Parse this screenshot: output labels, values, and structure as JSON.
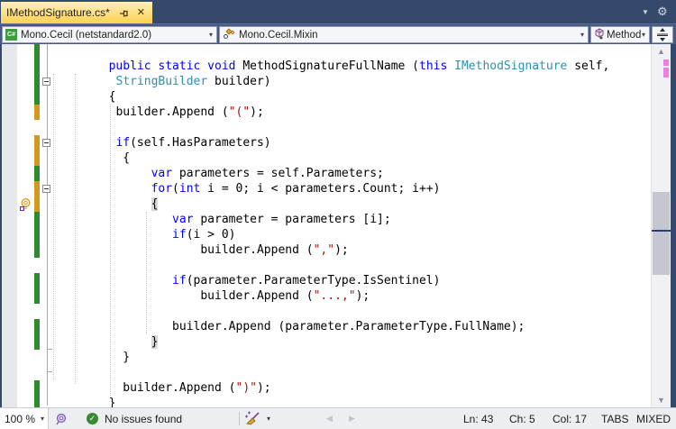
{
  "tab": {
    "title": "IMethodSignature.cs*"
  },
  "tabstrip": {
    "overflow_icon": "▼",
    "gear_icon": "⚙"
  },
  "navbar": {
    "project": "Mono.Cecil (netstandard2.0)",
    "type_name": "Mono.Cecil.Mixin",
    "member": "MethodSignature",
    "caret": "▾"
  },
  "editor": {
    "lines": [
      {
        "ind": 8,
        "bar": "g",
        "box": false,
        "segs": [
          [
            "kw",
            "public static void "
          ],
          [
            "pl",
            "MethodSignatureFullName ("
          ],
          [
            "kw",
            "this"
          ],
          [
            "pl",
            " "
          ],
          [
            "ty",
            "IMethodSignature"
          ],
          [
            "pl",
            " self,"
          ]
        ]
      },
      {
        "ind": 9,
        "bar": "g",
        "box": true,
        "segs": [
          [
            "ty",
            "StringBuilder"
          ],
          [
            "pl",
            " builder)"
          ]
        ]
      },
      {
        "ind": 8,
        "bar": "g",
        "box": false,
        "segs": [
          [
            "pl",
            "{"
          ]
        ]
      },
      {
        "ind": 9,
        "bar": "o",
        "box": false,
        "segs": [
          [
            "pl",
            "builder.Append ("
          ],
          [
            "st",
            "\"(\""
          ],
          [
            "pl",
            ");"
          ]
        ]
      },
      {
        "ind": 0,
        "bar": "",
        "box": false,
        "segs": []
      },
      {
        "ind": 9,
        "bar": "o",
        "box": true,
        "segs": [
          [
            "kw",
            "if"
          ],
          [
            "pl",
            "(self.HasParameters)"
          ]
        ]
      },
      {
        "ind": 10,
        "bar": "o",
        "box": false,
        "segs": [
          [
            "pl",
            "{"
          ]
        ]
      },
      {
        "ind": 14,
        "bar": "g",
        "box": false,
        "segs": [
          [
            "kw",
            "var"
          ],
          [
            "pl",
            " parameters = self.Parameters;"
          ]
        ]
      },
      {
        "ind": 14,
        "bar": "o",
        "box": true,
        "segs": [
          [
            "kw",
            "for"
          ],
          [
            "pl",
            "("
          ],
          [
            "kw",
            "int"
          ],
          [
            "pl",
            " i = 0; i < parameters.Count; i++)"
          ]
        ]
      },
      {
        "ind": 14,
        "bar": "o",
        "box": false,
        "hl": true,
        "bulb": true,
        "segs": [
          [
            "pl",
            "{"
          ]
        ]
      },
      {
        "ind": 17,
        "bar": "g",
        "box": false,
        "segs": [
          [
            "kw",
            "var"
          ],
          [
            "pl",
            " parameter = parameters [i];"
          ]
        ]
      },
      {
        "ind": 17,
        "bar": "g",
        "box": false,
        "segs": [
          [
            "kw",
            "if"
          ],
          [
            "pl",
            "(i > 0)"
          ]
        ]
      },
      {
        "ind": 21,
        "bar": "g",
        "box": false,
        "segs": [
          [
            "pl",
            "builder.Append ("
          ],
          [
            "st",
            "\",\""
          ],
          [
            "pl",
            ");"
          ]
        ]
      },
      {
        "ind": 0,
        "bar": "",
        "box": false,
        "segs": []
      },
      {
        "ind": 17,
        "bar": "g",
        "box": false,
        "segs": [
          [
            "kw",
            "if"
          ],
          [
            "pl",
            "(parameter.ParameterType.IsSentinel)"
          ]
        ]
      },
      {
        "ind": 21,
        "bar": "g",
        "box": false,
        "segs": [
          [
            "pl",
            "builder.Append ("
          ],
          [
            "st",
            "\"...,\""
          ],
          [
            "pl",
            ");"
          ]
        ]
      },
      {
        "ind": 0,
        "bar": "",
        "box": false,
        "segs": []
      },
      {
        "ind": 17,
        "bar": "g",
        "box": false,
        "segs": [
          [
            "pl",
            "builder.Append (parameter.ParameterType.FullName);"
          ]
        ]
      },
      {
        "ind": 14,
        "bar": "g",
        "box": false,
        "hl": true,
        "segs": [
          [
            "pl",
            "}"
          ]
        ]
      },
      {
        "ind": 10,
        "bar": "",
        "box": false,
        "segs": [
          [
            "pl",
            "}"
          ]
        ]
      },
      {
        "ind": 0,
        "bar": "",
        "box": false,
        "segs": []
      },
      {
        "ind": 10,
        "bar": "g",
        "box": false,
        "segs": [
          [
            "pl",
            "builder.Append ("
          ],
          [
            "st",
            "\")\""
          ],
          [
            "pl",
            ");"
          ]
        ]
      },
      {
        "ind": 8,
        "bar": "g",
        "box": false,
        "segs": [
          [
            "pl",
            "}"
          ]
        ]
      }
    ]
  },
  "statusbar": {
    "zoom": "100 %",
    "issues": "No issues found",
    "check_glyph": "✓",
    "ln": "Ln: 43",
    "ch": "Ch: 5",
    "col": "Col: 17",
    "tabs_label": "TABS",
    "mixed_label": "MIXED",
    "hscroll_left": "◀",
    "hscroll_right": "▶"
  },
  "scrollbar": {
    "up_glyph": "▲",
    "down_glyph": "▼"
  },
  "colors": {
    "keyword": "#0000ff",
    "type": "#2b91af",
    "string": "#a31515",
    "plain": "#000000",
    "change_saved": "#2d8a2d",
    "change_unsaved": "#d19a1f",
    "tab_top": "#ffefbd",
    "tab_bottom": "#ffd24f",
    "annotation_pink": "#ef7de4",
    "caret_mark": "#2b3f7a",
    "issues_ok": "#388a34"
  }
}
